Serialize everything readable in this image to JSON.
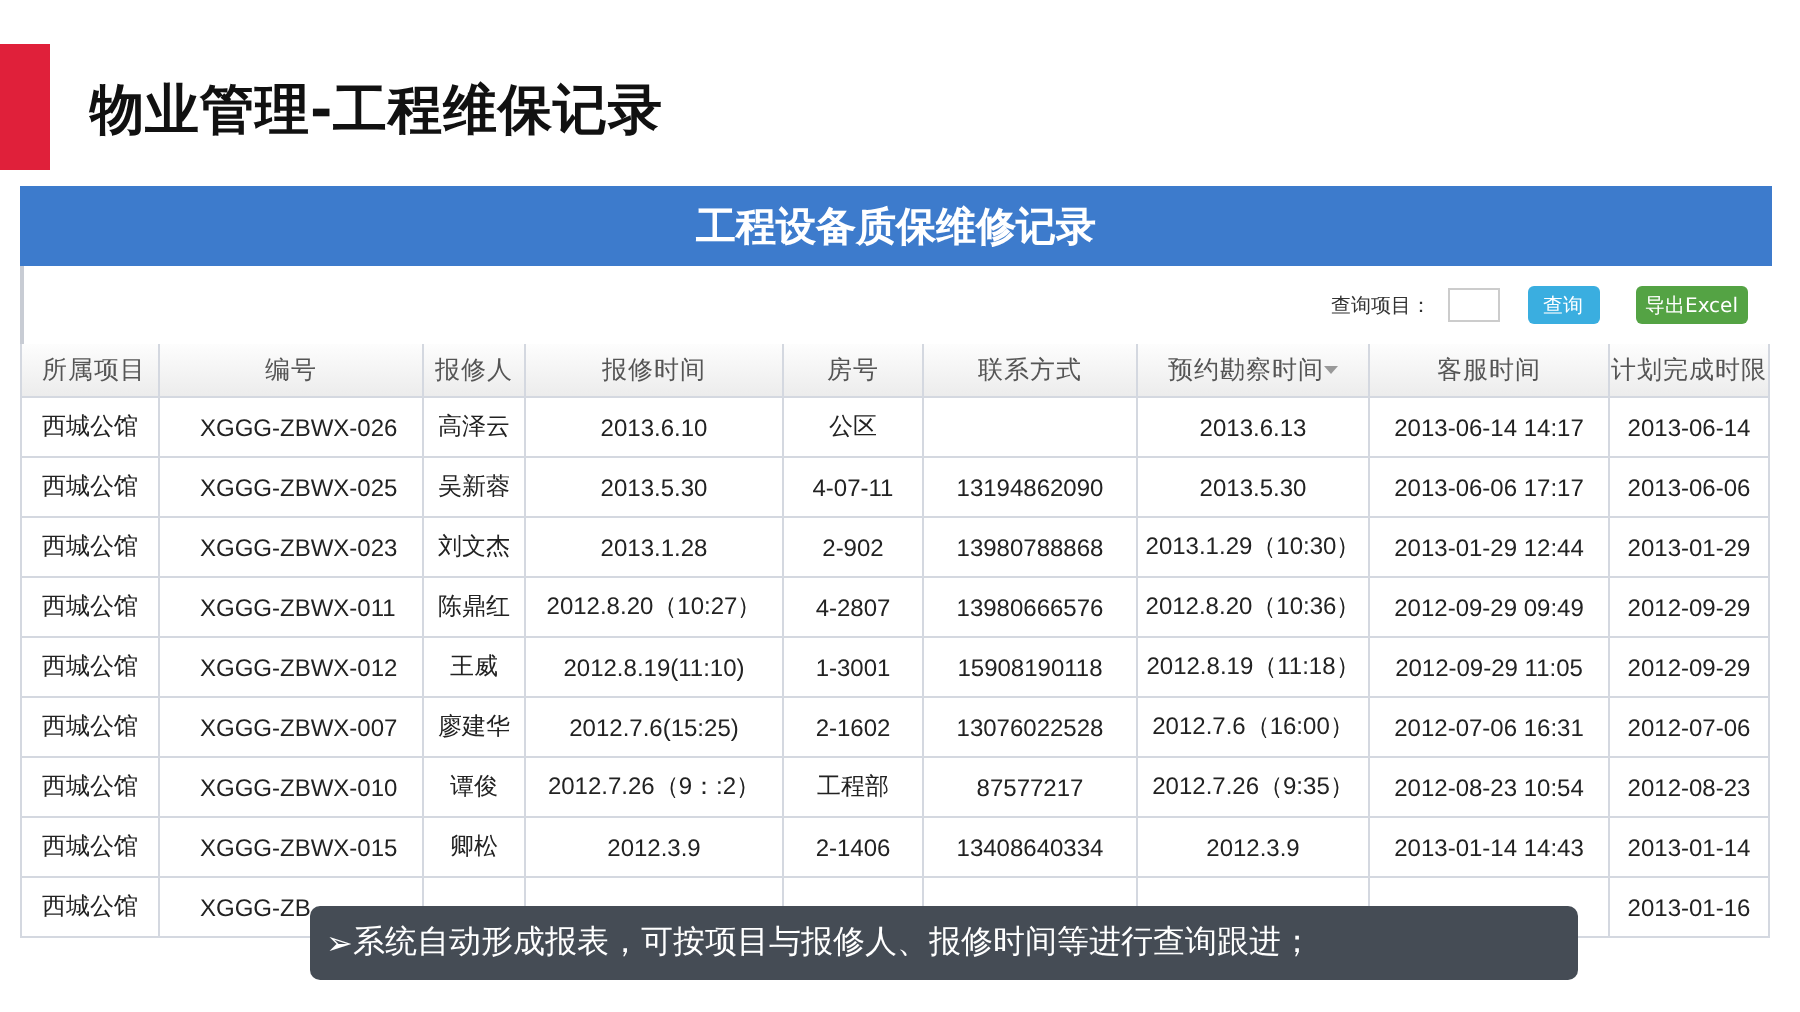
{
  "slide_title": "物业管理-工程维保记录",
  "report": {
    "title": "工程设备质保维修记录",
    "toolbar": {
      "query_label": "查询项目：",
      "query_button": "查询",
      "export_button": "导出Excel"
    },
    "table": {
      "columns": [
        {
          "label": "所属项目",
          "sorted": false
        },
        {
          "label": "编号",
          "sorted": false
        },
        {
          "label": "报修人",
          "sorted": false
        },
        {
          "label": "报修时间",
          "sorted": false
        },
        {
          "label": "房号",
          "sorted": false
        },
        {
          "label": "联系方式",
          "sorted": false
        },
        {
          "label": "预约勘察时间",
          "sorted": true
        },
        {
          "label": "客服时间",
          "sorted": false
        },
        {
          "label": "计划完成时限",
          "sorted": false
        }
      ],
      "rows": [
        [
          "西城公馆",
          "XGGG-ZBWX-026",
          "高泽云",
          "2013.6.10",
          "公区",
          null,
          "2013.6.13",
          "2013-06-14 14:17",
          "2013-06-14"
        ],
        [
          "西城公馆",
          "XGGG-ZBWX-025",
          "吴新蓉",
          "2013.5.30",
          "4-07-11",
          "13194862090",
          "2013.5.30",
          "2013-06-06 17:17",
          "2013-06-06"
        ],
        [
          "西城公馆",
          "XGGG-ZBWX-023",
          "刘文杰",
          "2013.1.28",
          "2-902",
          "13980788868",
          "2013.1.29（10:30）",
          "2013-01-29 12:44",
          "2013-01-29"
        ],
        [
          "西城公馆",
          "XGGG-ZBWX-011",
          "陈鼎红",
          "2012.8.20（10:27）",
          "4-2807",
          "13980666576",
          "2012.8.20（10:36）",
          "2012-09-29 09:49",
          "2012-09-29"
        ],
        [
          "西城公馆",
          "XGGG-ZBWX-012",
          "王威",
          "2012.8.19(11:10)",
          "1-3001",
          "15908190118",
          "2012.8.19（11:18）",
          "2012-09-29 11:05",
          "2012-09-29"
        ],
        [
          "西城公馆",
          "XGGG-ZBWX-007",
          "廖建华",
          "2012.7.6(15:25)",
          "2-1602",
          "13076022528",
          "2012.7.6（16:00）",
          "2012-07-06 16:31",
          "2012-07-06"
        ],
        [
          "西城公馆",
          "XGGG-ZBWX-010",
          "谭俊",
          "2012.7.26（9：:2）",
          "工程部",
          "87577217",
          "2012.7.26（9:35）",
          "2012-08-23 10:54",
          "2012-08-23"
        ],
        [
          "西城公馆",
          "XGGG-ZBWX-015",
          "卿松",
          "2012.3.9",
          "2-1406",
          "13408640334",
          "2012.3.9",
          "2013-01-14 14:43",
          "2013-01-14"
        ],
        [
          "西城公馆",
          "XGGG-ZB",
          null,
          null,
          null,
          null,
          null,
          null,
          "2013-01-16"
        ]
      ]
    }
  },
  "callout": {
    "bullet": "➢",
    "text": "系统自动形成报表，可按项目与报修人、报修时间等进行查询跟进；"
  }
}
